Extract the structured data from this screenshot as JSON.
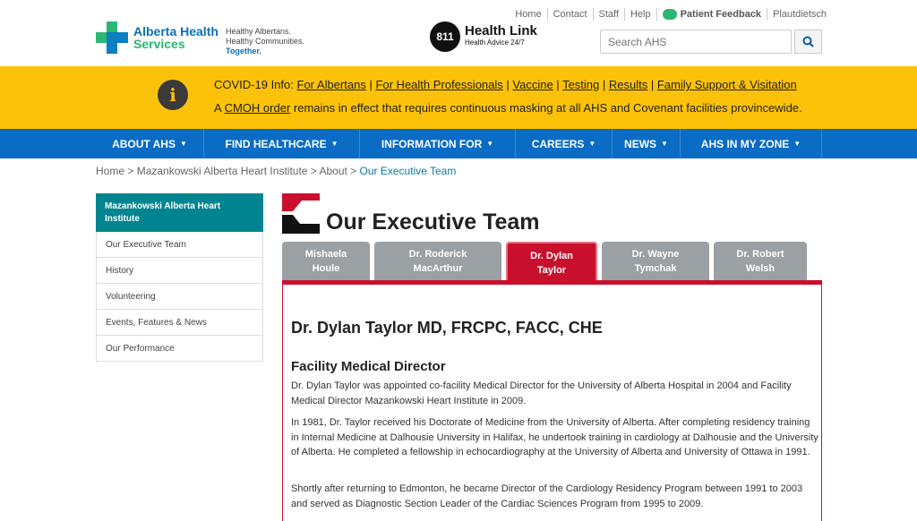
{
  "header": {
    "logo_line1": "Alberta Health",
    "logo_line2": "Services",
    "tagline1": "Healthy Albertans.",
    "tagline2": "Healthy Communities.",
    "tagline3": "Together.",
    "healthlink_number": "811",
    "healthlink_title": "Health Link",
    "healthlink_sub": "Health Advice 24/7",
    "toplinks": [
      "Home",
      "Contact",
      "Staff",
      "Help"
    ],
    "feedback": "Patient Feedback",
    "language": "Plautdietsch",
    "search_placeholder": "Search AHS"
  },
  "covid": {
    "prefix": "COVID-19 Info:",
    "links": [
      "For Albertans",
      "For Health Professionals",
      "Vaccine",
      "Testing",
      "Results",
      "Family Support & Visitation"
    ],
    "line2_pre": "A",
    "line2_link": "CMOH order",
    "line2_post": "remains in effect that requires continuous masking at all AHS and Covenant facilities provincewide."
  },
  "nav": [
    "ABOUT AHS",
    "FIND HEALTHCARE",
    "INFORMATION FOR",
    "CAREERS",
    "NEWS",
    "AHS IN MY ZONE"
  ],
  "breadcrumb": {
    "items": [
      "Home",
      "Mazankowski Alberta Heart Institute",
      "About"
    ],
    "current": "Our Executive Team"
  },
  "sidebar": {
    "heading": "Mazankowski Alberta Heart Institute",
    "items": [
      "Our Executive Team",
      "History",
      "Volunteering",
      "Events, Features & News",
      "Our Performance"
    ]
  },
  "page_title": "Our Executive Team",
  "tabs": [
    {
      "line1": "Mishaela",
      "line2": "Houle"
    },
    {
      "line1": "Dr. Roderick",
      "line2": "MacArthur"
    },
    {
      "line1": "Dr. Dylan",
      "line2": "Taylor"
    },
    {
      "line1": "Dr. Wayne",
      "line2": "Tymchak"
    },
    {
      "line1": "Dr. Robert",
      "line2": "Welsh"
    }
  ],
  "profile": {
    "name": "Dr. Dylan Taylor MD, FRCPC, FACC, CHE",
    "role": "Facility Medical Director",
    "paragraphs": [
      "Dr. Dylan Taylor was appointed co-facility Medical Director for the University of Alberta Hospital in 2004 and Facility Medical Director Mazankowski Heart Institute in 2009.",
      "In 1981, Dr. Taylor received his Doctorate of Medicine from the University of Alberta. After completing residency training in Internal Medicine at Dalhousie University in Halifax, he undertook training in cardiology at Dalhousie and the University of Alberta. He completed a fellowship in echocardiography at the University of Alberta and University of Ottawa in 1991.",
      "Shortly after returning to Edmonton, he became Director of the Cardiology Residency Program between 1991 to 2003 and served as Diagnostic Section Leader of the Cardiac Sciences Program from 1995 to 2009."
    ]
  },
  "colors": {
    "brand_blue": "#0a6cc4",
    "banner_yellow": "#fcc20a",
    "accent_red": "#c8102e",
    "teal": "#008590"
  }
}
